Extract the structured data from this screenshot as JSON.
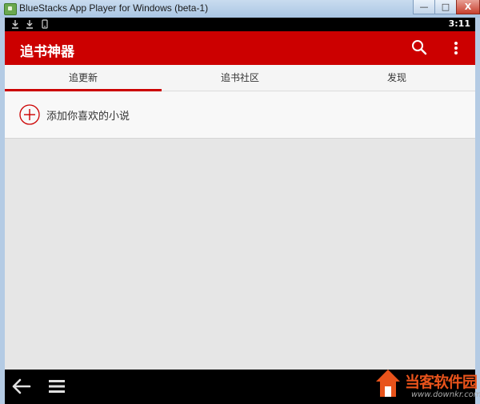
{
  "window": {
    "title": "BlueStacks App Player for Windows (beta-1)",
    "minimize_glyph": "—",
    "maximize_glyph": "□",
    "close_glyph": "X"
  },
  "statusbar": {
    "time": "3:11",
    "icons": [
      "download-icon",
      "download-icon",
      "phone-icon"
    ]
  },
  "appbar": {
    "title": "追书神器",
    "color": "#cc0000",
    "actions": [
      "search-icon",
      "more-icon"
    ]
  },
  "tabs": [
    {
      "label": "追更新",
      "selected": true
    },
    {
      "label": "追书社区",
      "selected": false
    },
    {
      "label": "发现",
      "selected": false
    }
  ],
  "main": {
    "add_label": "添加你喜欢的小说"
  },
  "navbar": {
    "icons": [
      "back-arrow-icon",
      "menu-icon"
    ]
  },
  "watermark": {
    "text": "当客软件园",
    "url": "www.downkr.com"
  }
}
